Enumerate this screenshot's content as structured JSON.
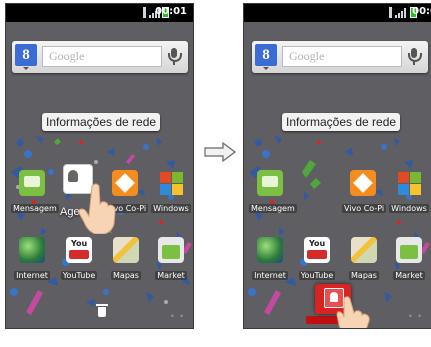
{
  "screens": [
    {
      "status": {
        "time": "00:01"
      },
      "search": {
        "placeholder": "Google"
      },
      "widget": {
        "label": "Informações de rede"
      },
      "apps": [
        {
          "label": "Mensagem"
        },
        {
          "label": "Agen"
        },
        {
          "label": "Vivo Co-Pi"
        },
        {
          "label": "Windows"
        },
        {
          "label": "Internet"
        },
        {
          "label": "YouTube"
        },
        {
          "label": "Mapas"
        },
        {
          "label": "Market"
        }
      ]
    },
    {
      "status": {
        "time": "00:0"
      },
      "search": {
        "placeholder": "Google"
      },
      "widget": {
        "label": "Informações de rede"
      },
      "apps": [
        {
          "label": "Mensagem"
        },
        {
          "label": "Vivo Co-Pi"
        },
        {
          "label": "Windows"
        },
        {
          "label": "Internet"
        },
        {
          "label": "YouTube"
        },
        {
          "label": "Mapas"
        },
        {
          "label": "Market"
        }
      ]
    }
  ],
  "colors": {
    "wallpaper_blue": "#2e5aa8",
    "wallpaper_green": "#4fa83a",
    "drop_target_red": "#d92323"
  },
  "icons": [
    "usb-icon",
    "signal-icon",
    "battery-icon",
    "google-logo",
    "mic-icon",
    "trash-icon",
    "arrow-right-icon",
    "hand-pointer-icon"
  ]
}
